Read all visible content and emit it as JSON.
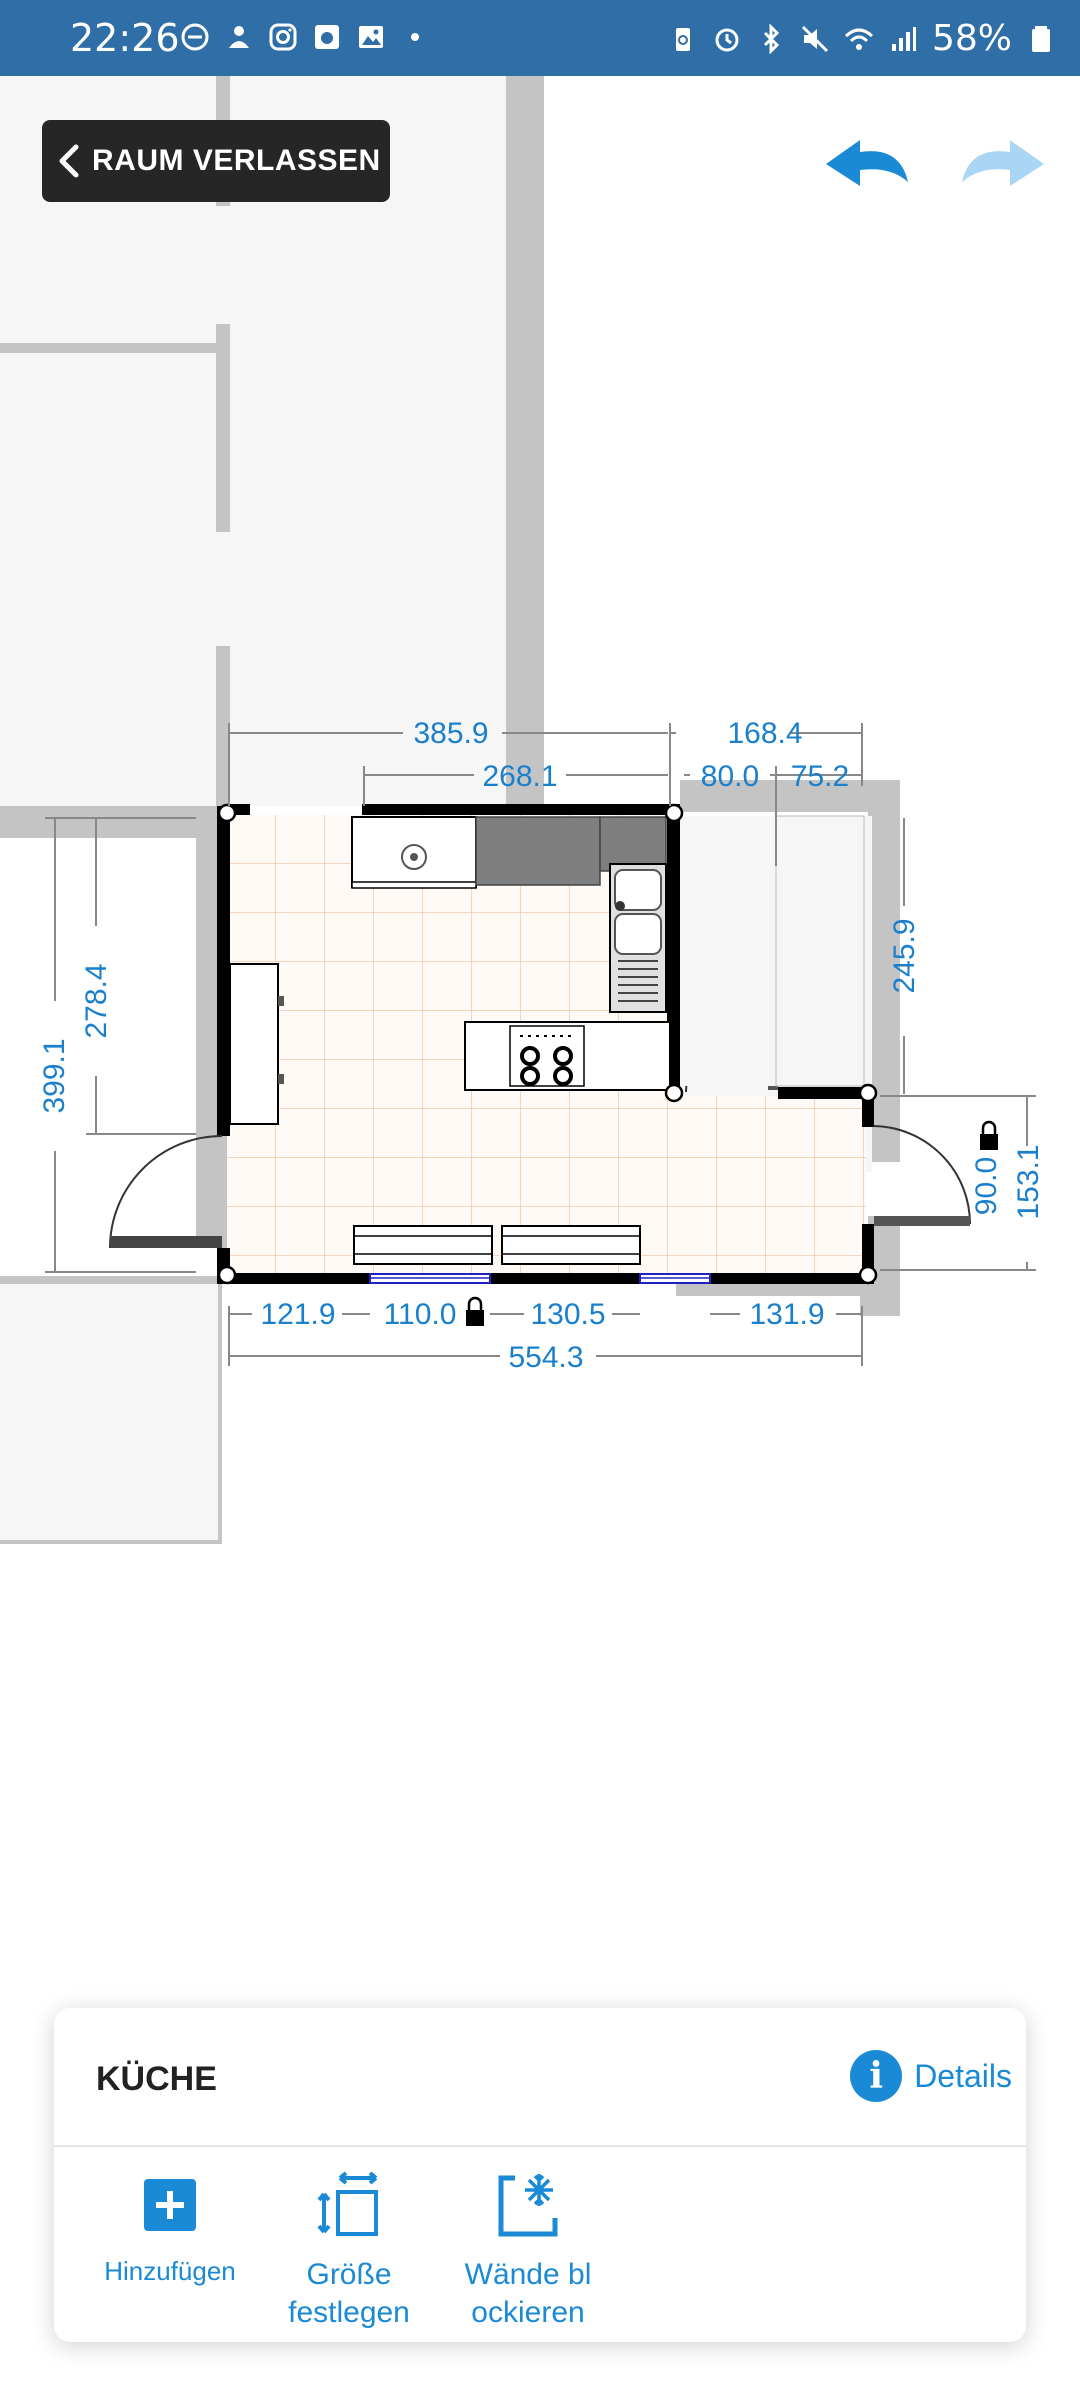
{
  "status_bar": {
    "time": "22:26",
    "battery": "58%"
  },
  "toolbar": {
    "leave_label": "RAUM VERLASSEN"
  },
  "floorplan": {
    "dimensions": {
      "top_total": "385.9",
      "top_right": "168.4",
      "inner_top": "268.1",
      "top_small_a": "80.0",
      "top_small_b": "75.2",
      "left_outer": "399.1",
      "left_inner": "278.4",
      "right_upper": "245.9",
      "right_door": "90.0",
      "right_total": "153.1",
      "bottom_a": "121.9",
      "bottom_b": "110.0",
      "bottom_c": "130.5",
      "bottom_d": "131.9",
      "bottom_total": "554.3"
    }
  },
  "panel": {
    "room_title": "KÜCHE",
    "details_label": "Details",
    "tools": [
      {
        "label_line1": "Hinzufügen",
        "label_line2": ""
      },
      {
        "label_line1": "Größe",
        "label_line2": "festlegen"
      },
      {
        "label_line1": "Wände bl",
        "label_line2": "ockieren"
      }
    ]
  },
  "colors": {
    "status_bar": "#2f6ea6",
    "accent": "#1a8ad6",
    "wall": "#000000",
    "tile_line": "#f6c9a6"
  }
}
